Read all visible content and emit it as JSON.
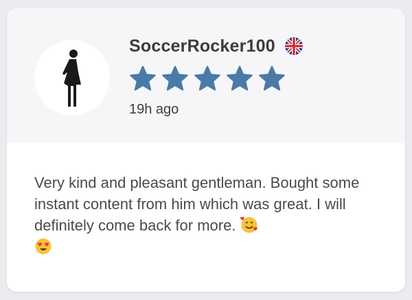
{
  "review": {
    "username": "SoccerRocker100",
    "country_flag": "uk-flag-icon",
    "rating": 5,
    "rating_max": 5,
    "star_color": "#4a7aa8",
    "timestamp": "19h ago",
    "text": "Very kind and pleasant gentleman. Bought some instant content from him which was great. I will definitely come back for more.",
    "emojis": [
      "smiling-face-with-hearts-icon",
      "heart-eyes-icon"
    ]
  }
}
